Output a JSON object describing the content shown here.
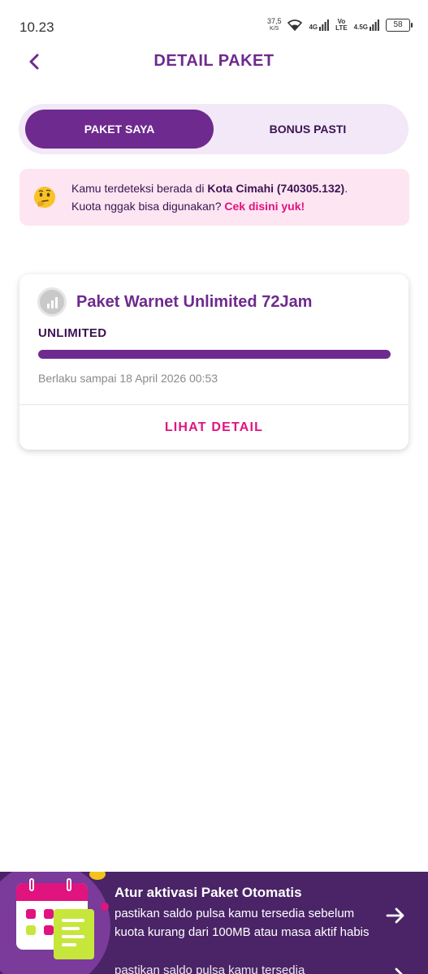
{
  "status_bar": {
    "time": "10.23",
    "net_speed": "37,5",
    "net_speed_unit": "K/S",
    "signal_1": "4G",
    "volte": "Vo\nLTE",
    "signal_2": "4.5G",
    "battery": "58"
  },
  "header": {
    "title": "DETAIL PAKET"
  },
  "tabs": [
    {
      "label": "PAKET SAYA",
      "active": true
    },
    {
      "label": "BONUS PASTI",
      "active": false
    }
  ],
  "notice": {
    "text_1": "Kamu terdeteksi berada di ",
    "location": "Kota Cimahi (740305.132)",
    "text_2": ".",
    "text_3": "Kuota nggak bisa digunakan? ",
    "link": "Cek disini yuk!"
  },
  "package": {
    "name": "Paket Warnet Unlimited 72Jam",
    "quota_label": "UNLIMITED",
    "progress_fraction": 1.0,
    "validity": "Berlaku sampai 18 April 2026 00:53",
    "detail_button": "LIHAT DETAIL"
  },
  "banner": {
    "title": "Atur aktivasi Paket Otomatis",
    "description": "pastikan saldo pulsa kamu tersedia sebelum kuota kurang dari 100MB atau masa aktif habis",
    "ghost_text": "pastikan saldo pulsa kamu tersedia"
  },
  "colors": {
    "primary": "#6e2a8e",
    "accent": "#e0137f",
    "notice_bg": "#fde5f1",
    "banner_bg": "#4a2467"
  }
}
